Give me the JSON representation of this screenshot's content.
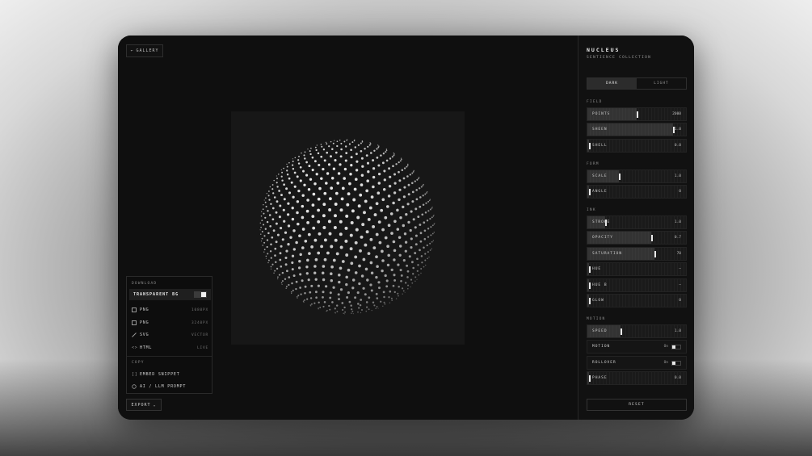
{
  "canvas": {
    "gallery_label": "GALLERY",
    "export_label": "EXPORT"
  },
  "download_menu": {
    "download_heading": "DOWNLOAD",
    "transparent_bg_label": "TRANSPARENT BG",
    "items": [
      {
        "icon": "image-icon",
        "label": "PNG",
        "detail": "1080PX"
      },
      {
        "icon": "image-icon",
        "label": "PNG",
        "detail": "3240PX"
      },
      {
        "icon": "pen-icon",
        "label": "SVG",
        "detail": "VECTOR"
      },
      {
        "icon": "code-icon",
        "label": "HTML",
        "detail": "LIVE"
      }
    ],
    "copy_heading": "COPY",
    "copy_items": [
      {
        "icon": "brackets-icon",
        "label": "EMBED SNIPPET"
      },
      {
        "icon": "chat-icon",
        "label": "AI / LLM PROMPT"
      }
    ]
  },
  "panel": {
    "title": "NUCLEUS",
    "subtitle": "SENTIENCE COLLECTION",
    "theme": {
      "dark": "DARK",
      "light": "LIGHT"
    },
    "sections": {
      "field": "FIELD",
      "form": "FORM",
      "ink": "INK",
      "motion": "MOTION"
    },
    "sliders": {
      "points": {
        "label": "POINTS",
        "value": "2000",
        "level": 0.5
      },
      "sheen": {
        "label": "SHEEN",
        "value": "1.0",
        "level": 0.87
      },
      "shell": {
        "label": "SHELL",
        "value": "0.0",
        "level": 0.02
      },
      "scale": {
        "label": "SCALE",
        "value": "1.0",
        "level": 0.32
      },
      "angle": {
        "label": "ANGLE",
        "value": "0",
        "level": 0.02
      },
      "stroke": {
        "label": "STROKE",
        "value": "1.0",
        "level": 0.18
      },
      "opacity": {
        "label": "OPACITY",
        "value": "0.7",
        "level": 0.65
      },
      "saturation": {
        "label": "SATURATION",
        "value": "70",
        "level": 0.68
      },
      "hue": {
        "label": "HUE",
        "value": "—",
        "level": 0.02
      },
      "hue_b": {
        "label": "HUE B",
        "value": "—",
        "level": 0.02
      },
      "glow": {
        "label": "GLOW",
        "value": "0",
        "level": 0.02
      },
      "speed": {
        "label": "SPEED",
        "value": "1.0",
        "level": 0.34
      },
      "phase": {
        "label": "PHASE",
        "value": "0.0",
        "level": 0.02
      }
    },
    "toggles": {
      "motion": {
        "label": "MOTION",
        "state": "On"
      },
      "rollover": {
        "label": "ROLLOVER",
        "state": "On"
      }
    },
    "reset_label": "RESET"
  }
}
